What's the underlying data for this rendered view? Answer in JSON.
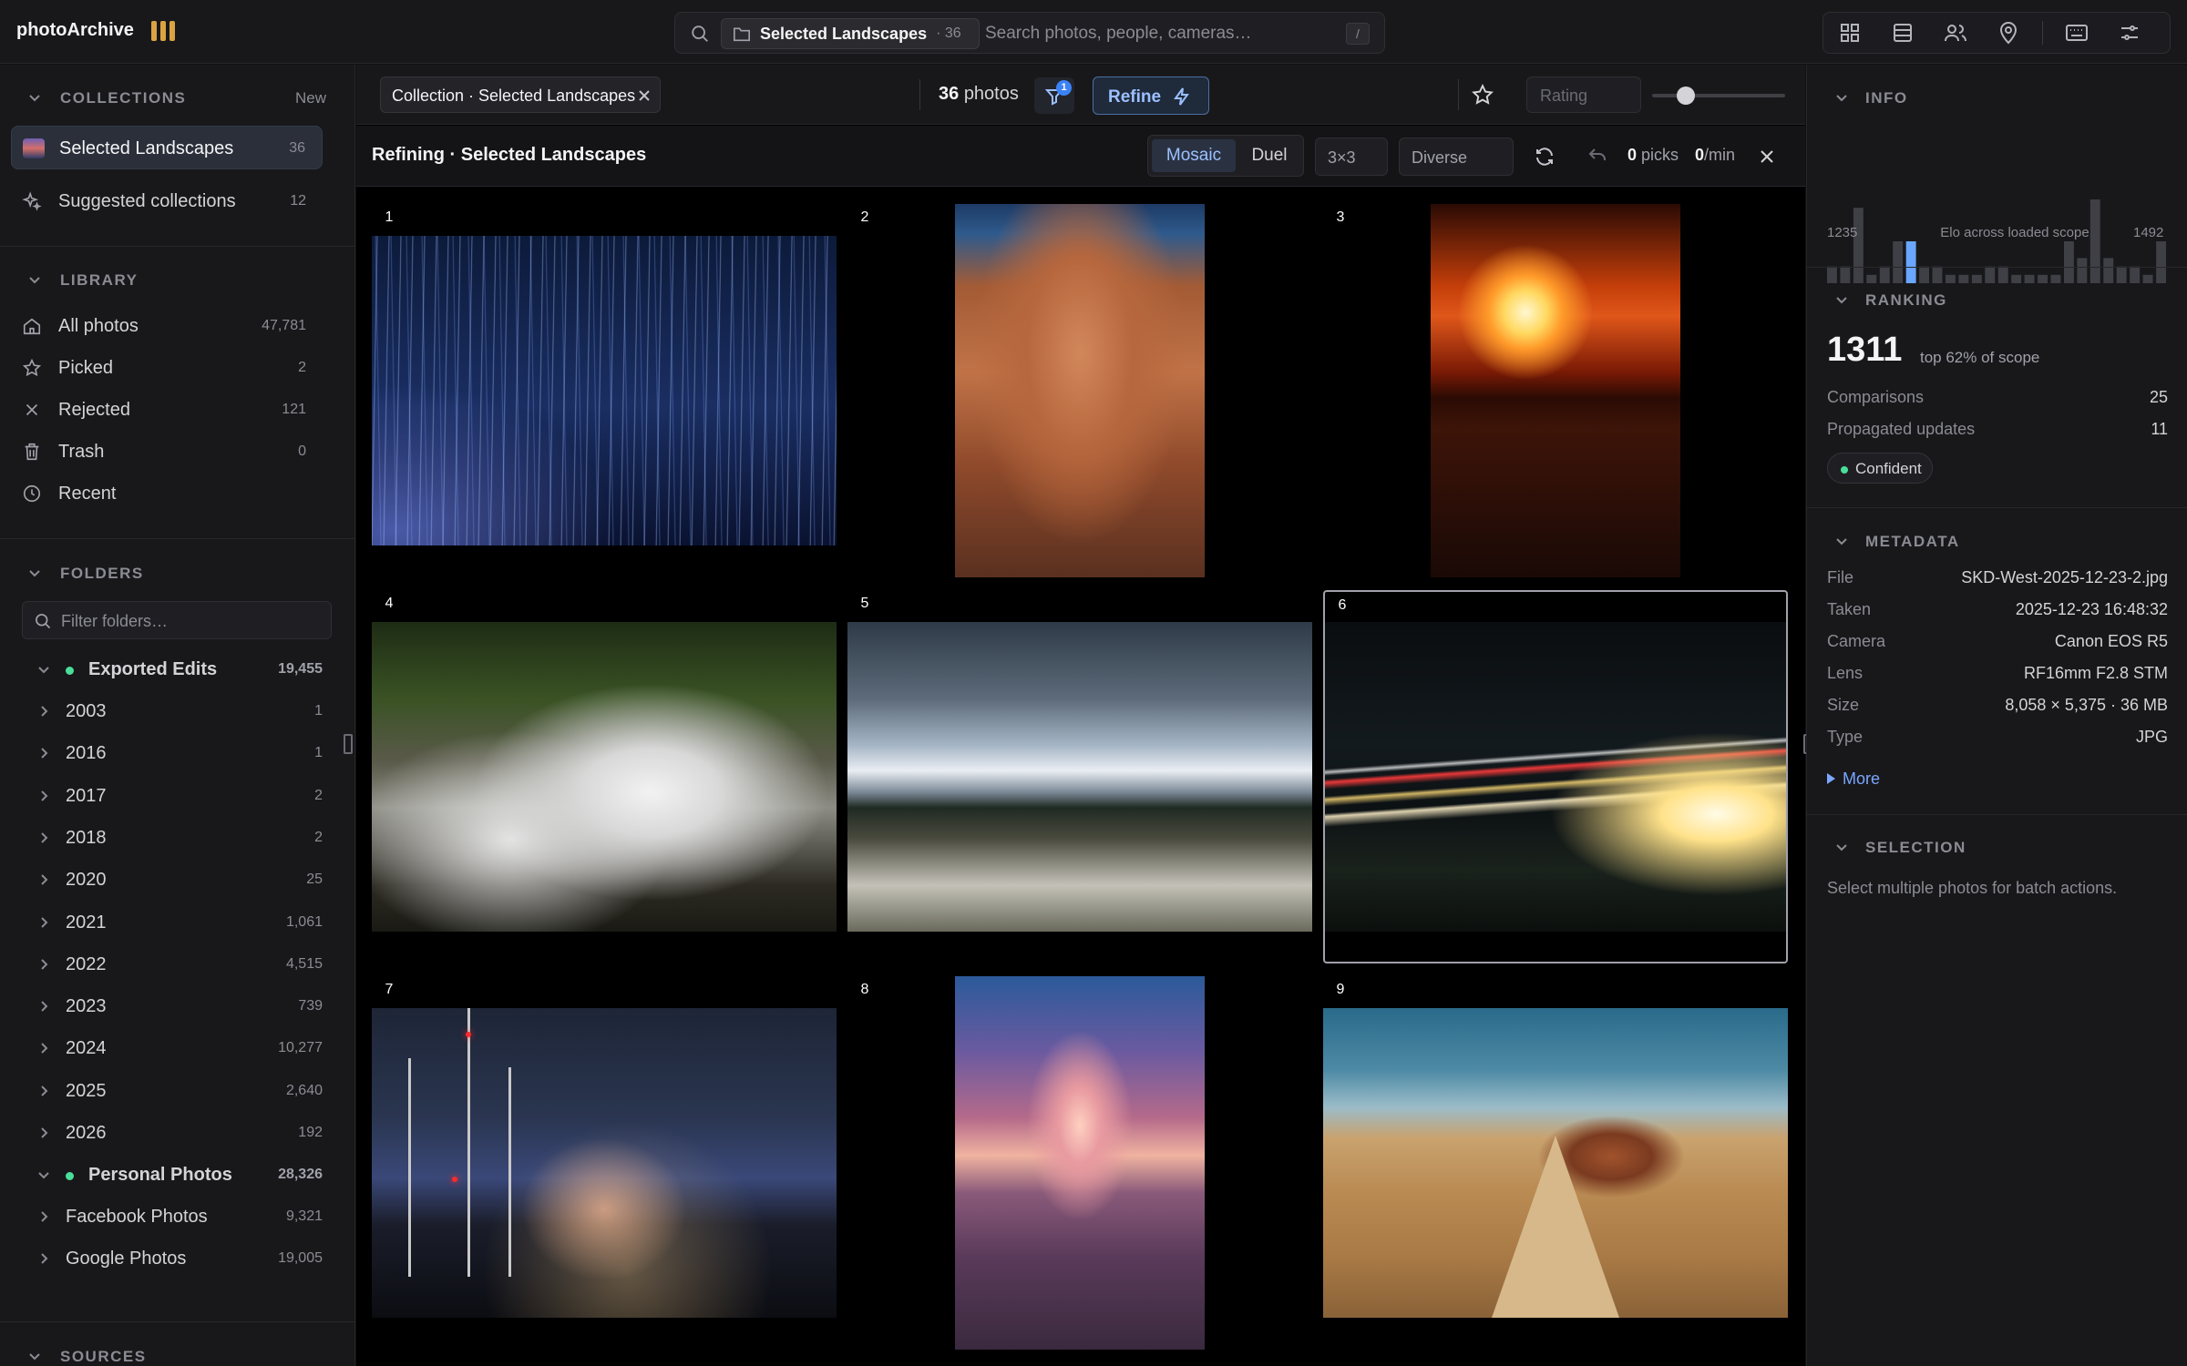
{
  "app": {
    "brand": "photoArchive"
  },
  "search": {
    "scope_name": "Selected Landscapes",
    "scope_count": "· 36",
    "placeholder": "Search photos, people, cameras…",
    "shortcut": "/"
  },
  "sidebar": {
    "collections": {
      "title": "COLLECTIONS",
      "new_label": "New",
      "items": [
        {
          "label": "Selected Landscapes",
          "count": "36"
        },
        {
          "label": "Suggested collections",
          "count": "12"
        }
      ]
    },
    "library": {
      "title": "LIBRARY",
      "items": [
        {
          "label": "All photos",
          "count": "47,781"
        },
        {
          "label": "Picked",
          "count": "2"
        },
        {
          "label": "Rejected",
          "count": "121"
        },
        {
          "label": "Trash",
          "count": "0"
        },
        {
          "label": "Recent",
          "count": ""
        }
      ]
    },
    "folders": {
      "title": "FOLDERS",
      "filter_placeholder": "Filter folders…",
      "groups": [
        {
          "label": "Exported Edits",
          "count": "19,455",
          "children": [
            {
              "label": "2003",
              "count": "1"
            },
            {
              "label": "2016",
              "count": "1"
            },
            {
              "label": "2017",
              "count": "2"
            },
            {
              "label": "2018",
              "count": "2"
            },
            {
              "label": "2020",
              "count": "25"
            },
            {
              "label": "2021",
              "count": "1,061"
            },
            {
              "label": "2022",
              "count": "4,515"
            },
            {
              "label": "2023",
              "count": "739"
            },
            {
              "label": "2024",
              "count": "10,277"
            },
            {
              "label": "2025",
              "count": "2,640"
            },
            {
              "label": "2026",
              "count": "192"
            }
          ]
        },
        {
          "label": "Personal Photos",
          "count": "28,326",
          "children": [
            {
              "label": "Facebook Photos",
              "count": "9,321"
            },
            {
              "label": "Google Photos",
              "count": "19,005"
            }
          ]
        }
      ]
    },
    "sources": {
      "title": "SOURCES"
    }
  },
  "toolbar": {
    "collection_chip": "Collection · Selected Landscapes",
    "photo_count": "36",
    "photo_count_label": "photos",
    "filter_badge": "1",
    "refine_label": "Refine",
    "rating_placeholder": "Rating",
    "zoom_level": 0.25
  },
  "refine_bar": {
    "title": "Refining · Selected Landscapes",
    "modes": [
      "Mosaic",
      "Duel"
    ],
    "active_mode": "Mosaic",
    "grid_size": "3×3",
    "strategy": "Diverse",
    "picks_value": "0",
    "picks_label": "picks",
    "rate_value": "0",
    "rate_label": "/min"
  },
  "grid": {
    "tiles": [
      {
        "num": "1",
        "subject": "star-trails"
      },
      {
        "num": "2",
        "subject": "sandstone-cliff"
      },
      {
        "num": "3",
        "subject": "sunset"
      },
      {
        "num": "4",
        "subject": "waterfall"
      },
      {
        "num": "5",
        "subject": "snowy-mountains"
      },
      {
        "num": "6",
        "subject": "light-trails",
        "selected": true
      },
      {
        "num": "7",
        "subject": "radio-towers"
      },
      {
        "num": "8",
        "subject": "beach-sunset"
      },
      {
        "num": "9",
        "subject": "desert-road"
      }
    ]
  },
  "info": {
    "title": "INFO",
    "hist_min": "1235",
    "hist_caption": "Elo across loaded scope",
    "hist_max": "1492",
    "hist_values": [
      2,
      2,
      9,
      1,
      2,
      5,
      5,
      2,
      2,
      1,
      1,
      1,
      2,
      2,
      1,
      1,
      1,
      1,
      5,
      3,
      10,
      3,
      2,
      2,
      1,
      5
    ],
    "hist_highlight": 6
  },
  "ranking": {
    "title": "RANKING",
    "score": "1311",
    "percentile": "top 62% of scope",
    "rows": [
      {
        "k": "Comparisons",
        "v": "25"
      },
      {
        "k": "Propagated updates",
        "v": "11"
      }
    ],
    "badge": "Confident"
  },
  "metadata": {
    "title": "METADATA",
    "rows": [
      {
        "k": "File",
        "v": "SKD-West-2025-12-23-2.jpg"
      },
      {
        "k": "Taken",
        "v": "2025-12-23 16:48:32"
      },
      {
        "k": "Camera",
        "v": "Canon EOS R5"
      },
      {
        "k": "Lens",
        "v": "RF16mm F2.8 STM"
      },
      {
        "k": "Size",
        "v": "8,058 × 5,375 · 36 MB"
      },
      {
        "k": "Type",
        "v": "JPG"
      }
    ],
    "more_label": "More"
  },
  "selection": {
    "title": "SELECTION",
    "note": "Select multiple photos for batch actions."
  },
  "colors": {
    "accent": "#3b82f6",
    "accent_text": "#9cc0ff",
    "status_green": "#4ade9a",
    "brand_yellow": "#d9a441"
  }
}
